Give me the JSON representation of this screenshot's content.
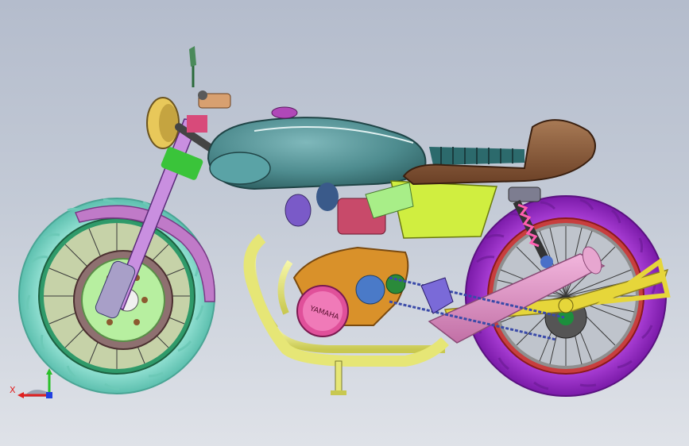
{
  "viewport": {
    "engine_cover_text": "YAMAHA",
    "triad": {
      "x_label": "X"
    }
  },
  "colors": {
    "background_top": "#b4bccc",
    "background_bottom": "#dfe2e8",
    "front_tire": "#8fe0d0",
    "rear_tire": "#a52cd8",
    "fuel_tank": "#4e8c8f",
    "seat": "#8a5a3a",
    "exhaust": "#d98fc0",
    "frame": "#e6e67a",
    "engine_case": "#d9912a",
    "side_panel": "#d0ee40"
  }
}
